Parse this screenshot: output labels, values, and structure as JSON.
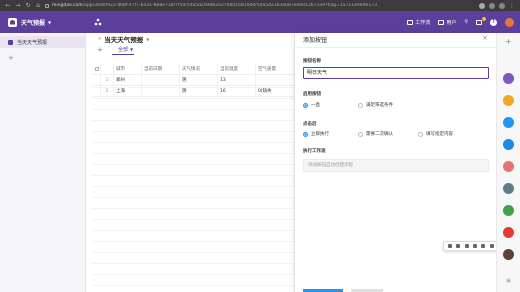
{
  "browser": {
    "url_host": "mingdao.com",
    "url_path": "/app/3ed0f922-d68f-47f7-b5a1-8b8e73af7f50/5da5d20d9b2e2700016810dd/5da5d21b3eb87e0001267339?flag=1571149696173"
  },
  "appbar": {
    "app_name": "天气预报",
    "tasks_label": "工作流",
    "users_label": "用户",
    "notify_count": "3",
    "help_label": "?"
  },
  "sidebar": {
    "items": [
      {
        "label": "当天天气预报"
      }
    ],
    "add_label": "+"
  },
  "worksheet": {
    "title": "当天天气预报",
    "view_tab": "全部",
    "columns": [
      "城市",
      "当前日期",
      "天气情况",
      "当前温度",
      "空气质量"
    ],
    "rows": [
      {
        "num": "1",
        "city": "郑州",
        "date": "",
        "weather": "阴",
        "temp": "13",
        "air": ""
      },
      {
        "num": "2",
        "city": "上海",
        "date": "",
        "weather": "阴",
        "temp": "16",
        "air": "0(缺失"
      }
    ]
  },
  "panel": {
    "title": "添加按钮",
    "name_label": "按钮名称",
    "name_value": "明日天气",
    "enable_label": "启用按钮",
    "enable_options": [
      {
        "label": "一直",
        "selected": true
      },
      {
        "label": "满足筛选条件",
        "selected": false
      }
    ],
    "click_label": "点击后",
    "click_options": [
      {
        "label": "立即执行",
        "selected": true
      },
      {
        "label": "需要二次确认",
        "selected": false
      },
      {
        "label": "填写指定内容",
        "selected": false
      }
    ],
    "workflow_label": "执行工作流",
    "workflow_placeholder": "添加按钮自动创建流程"
  },
  "dock": {
    "icons": [
      {
        "name": "purple-app-icon",
        "color": "#7e57c2"
      },
      {
        "name": "orange-app-icon",
        "color": "#f5a623"
      },
      {
        "name": "blue-app-icon",
        "color": "#2196f3"
      },
      {
        "name": "blue-chat-icon",
        "color": "#1e88e5"
      },
      {
        "name": "pink-avatar-icon",
        "color": "#e57373"
      },
      {
        "name": "gray-app-icon",
        "color": "#607d8b"
      },
      {
        "name": "green-check-icon",
        "color": "#43a047"
      },
      {
        "name": "red-app-icon",
        "color": "#e53935"
      },
      {
        "name": "photo-avatar-icon",
        "color": "#5d4037"
      }
    ]
  }
}
